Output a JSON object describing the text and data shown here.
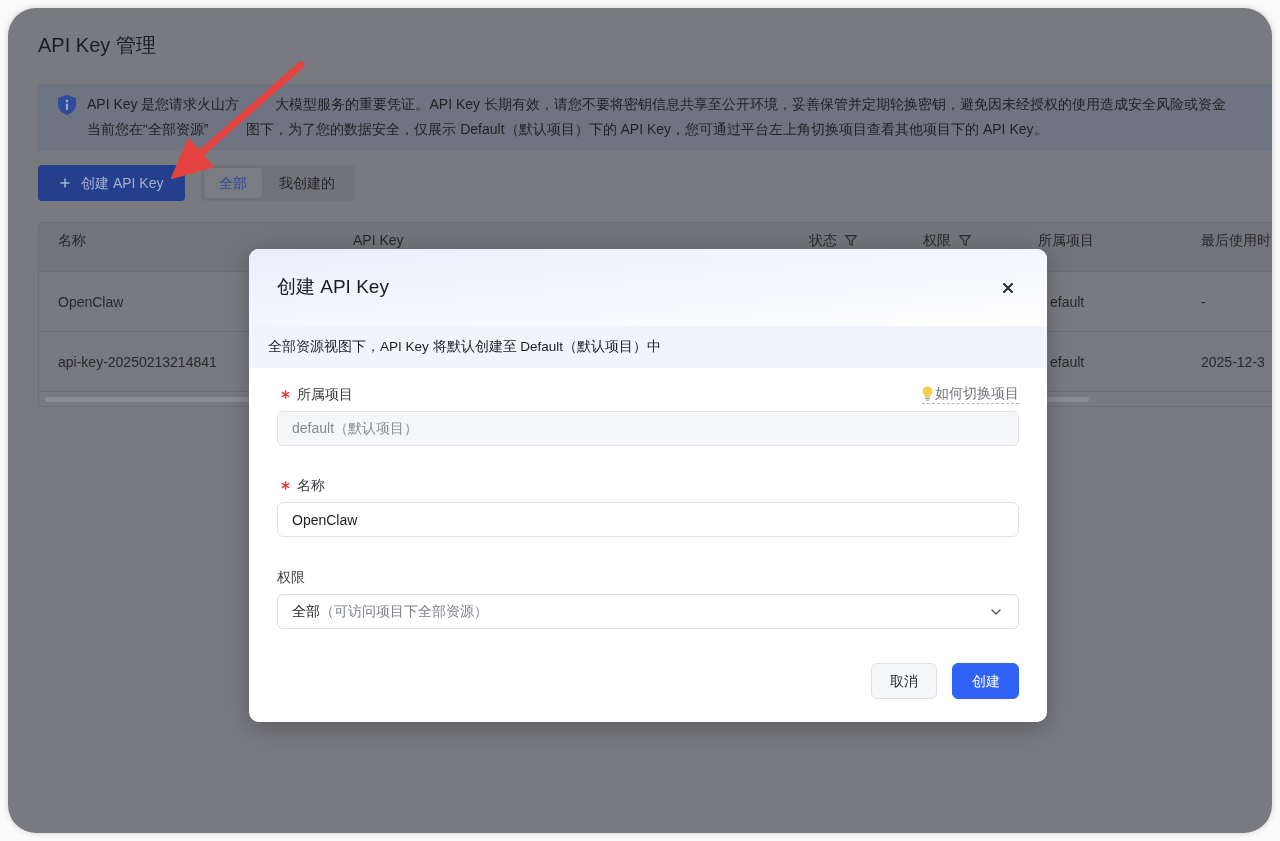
{
  "page": {
    "title": "API Key 管理"
  },
  "notice": {
    "lines": [
      [
        "API Key 是您请求火山方",
        "大模型服务的重要凭证。API Key 长期有效，请您不要将密钥信息共享至公开环境，妥善保管并定期轮换密钥，避免因未经授权的使用造成安全风险或资金"
      ],
      [
        "当前您在“全部资源”",
        "图下，为了您的数据安全，仅展示 Default（默认项目）下的 API Key，您可通过平台左上角切换项目查看其他项目下的 API Key。"
      ]
    ]
  },
  "toolbar": {
    "create_button": "创建 API Key",
    "tabs": [
      {
        "label": "全部",
        "selected": true
      },
      {
        "label": "我创建的",
        "selected": false
      }
    ]
  },
  "table": {
    "columns": [
      {
        "label": "名称",
        "filterable": false
      },
      {
        "label": "API Key",
        "filterable": false
      },
      {
        "label": "状态",
        "filterable": true
      },
      {
        "label": "权限",
        "filterable": true
      },
      {
        "label": "所属项目",
        "filterable": false
      },
      {
        "label": "最后使用时",
        "filterable": false
      }
    ],
    "rows": [
      {
        "name": "OpenClaw",
        "project": "efault",
        "last_used": "-"
      },
      {
        "name": "api-key-20250213214841",
        "project": "efault",
        "last_used": "2025-12-3"
      }
    ]
  },
  "dialog": {
    "title": "创建 API Key",
    "notice": "全部资源视图下，API Key 将默认创建至 Default（默认项目）中",
    "fields": [
      {
        "kind": "input",
        "label": "所属项目",
        "required": true,
        "help_link": "如何切换项目",
        "value": "default（默认项目）",
        "disabled": true
      },
      {
        "kind": "input",
        "label": "名称",
        "required": true,
        "value": "OpenClaw",
        "disabled": false
      },
      {
        "kind": "select",
        "label": "权限",
        "required": false,
        "value": "全部",
        "description": "（可访问项目下全部资源）",
        "disabled": false
      }
    ],
    "buttons": [
      {
        "label": "取消",
        "primary": false
      },
      {
        "label": "创建",
        "primary": true
      }
    ]
  }
}
